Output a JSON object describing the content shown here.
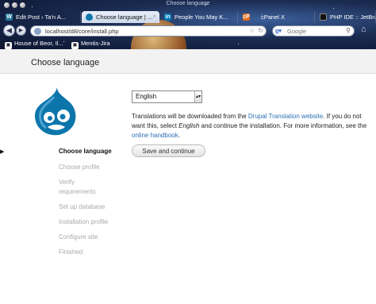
{
  "window": {
    "title": "Choose language"
  },
  "tabs": [
    {
      "label": "Edit Post ‹ Ta'n A...",
      "icon": "wordpress-icon",
      "active": false
    },
    {
      "label": "Choose language | ...",
      "icon": "drupal-icon",
      "active": true
    },
    {
      "label": "People You May K...",
      "icon": "linkedin-icon",
      "active": false
    },
    {
      "label": "cPanel X",
      "icon": "cpanel-icon",
      "active": false
    },
    {
      "label": "PHP IDE :: JetBra...",
      "icon": "jetbrains-icon",
      "active": false
    }
  ],
  "navbar": {
    "url": "localhost/d8/core/install.php",
    "search_placeholder": "Google"
  },
  "bookmarks": [
    {
      "label": "House of Beor, Il...",
      "icon": "bookmark-icon"
    },
    {
      "label": "Mentis-Jira",
      "icon": "bookmark-icon"
    }
  ],
  "page": {
    "title": "Choose language"
  },
  "steps": [
    {
      "label": "Choose language",
      "active": true
    },
    {
      "label": "Choose profile",
      "active": false
    },
    {
      "label": "Verify",
      "active": false
    },
    {
      "label": "requirements",
      "active": false
    },
    {
      "label": "Set up database",
      "active": false
    },
    {
      "label": "Installation profile",
      "active": false
    },
    {
      "label": "Configure site",
      "active": false
    },
    {
      "label": "Finished",
      "active": false
    }
  ],
  "language_select": {
    "value": "English"
  },
  "info": {
    "line1_prefix": "Translations will be downloaded from the ",
    "line1_link": "Drupal Translation website",
    "line1_suffix": ". If you do not",
    "line2_prefix": "want this, select ",
    "line2_em": "English",
    "line2_suffix": " and continue the installation. For more information, see the",
    "line3_link": "online handbook",
    "line3_suffix": "."
  },
  "actions": {
    "save_label": "Save and continue"
  },
  "colors": {
    "link": "#2a6fb5",
    "drupal_blue": "#0c76ab"
  }
}
